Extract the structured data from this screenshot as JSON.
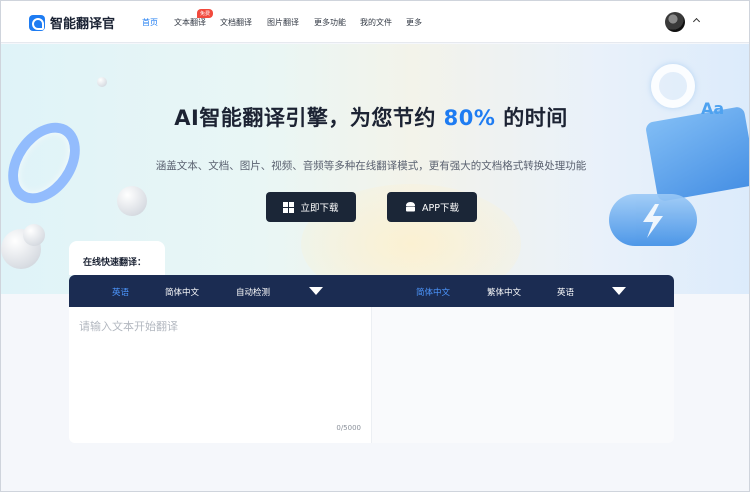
{
  "brand": {
    "name": "智能翻译官",
    "color": "#1e7cf2"
  },
  "nav": {
    "items": [
      {
        "label": "首页",
        "active": true
      },
      {
        "label": "文本翻译",
        "badge": "免费"
      },
      {
        "label": "文档翻译"
      },
      {
        "label": "图片翻译"
      },
      {
        "label": "更多功能"
      },
      {
        "label": "我的文件"
      },
      {
        "label": "更多"
      }
    ]
  },
  "hero": {
    "headline_pre": "AI智能翻译引擎，为您节约",
    "headline_highlight": "80%",
    "headline_post": "的时间",
    "subline": "涵盖文本、文档、图片、视频、音频等多种在线翻译模式，更有强大的文档格式转换处理功能",
    "buttons": [
      {
        "label": "立即下载",
        "icon": "windows-icon"
      },
      {
        "label": "APP下载",
        "icon": "android-icon"
      }
    ],
    "deco_text": "Aa"
  },
  "translator": {
    "section_label": "在线快速翻译：",
    "source_langs": [
      {
        "label": "英语",
        "active": true
      },
      {
        "label": "简体中文"
      },
      {
        "label": "自动检测"
      }
    ],
    "target_langs": [
      {
        "label": "简体中文",
        "active": true
      },
      {
        "label": "繁体中文"
      },
      {
        "label": "英语"
      }
    ],
    "input": {
      "value": "",
      "placeholder": "请输入文本开始翻译"
    },
    "counter": {
      "current": "0",
      "max": "/5000"
    }
  }
}
